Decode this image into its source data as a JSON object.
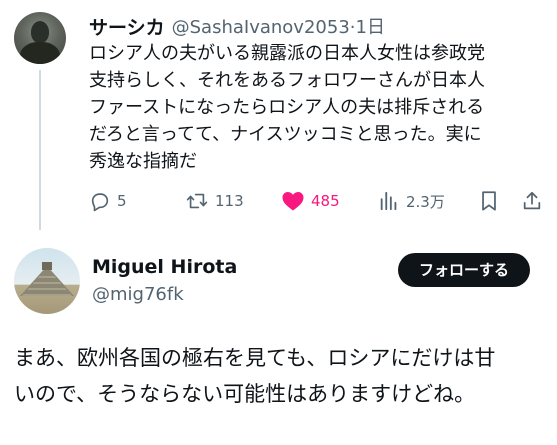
{
  "parent_tweet": {
    "display_name": "サーシカ",
    "handle_time": "@SashaIvanov2053·1日",
    "text": "ロシア人の夫がいる親露派の日本人女性は参政党\n支持らしく、それをあるフォロワーさんが日本人\nファーストになったらロシア人の夫は排斥される\nだろと言ってて、ナイスツッコミと思った。実に\n秀逸な指摘だ",
    "actions": {
      "reply_count": "5",
      "retweet_count": "113",
      "like_count": "485",
      "view_count": "2.3万"
    },
    "icons": {
      "reply": "reply-icon",
      "retweet": "retweet-icon",
      "like": "heart-icon",
      "views": "views-icon",
      "bookmark": "bookmark-icon",
      "share": "share-icon"
    }
  },
  "reply_tweet": {
    "display_name": "Miguel Hirota",
    "handle": "@mig76fk",
    "follow_label": "フォローする",
    "text": "まあ、欧州各国の極右を見ても、ロシアにだけは甘\nいので、そうならない可能性はありますけどね。"
  },
  "colors": {
    "text": "#0f1419",
    "secondary": "#536471",
    "like": "#f91880",
    "thread_line": "#cfd9de",
    "follow_bg": "#0f1419"
  }
}
